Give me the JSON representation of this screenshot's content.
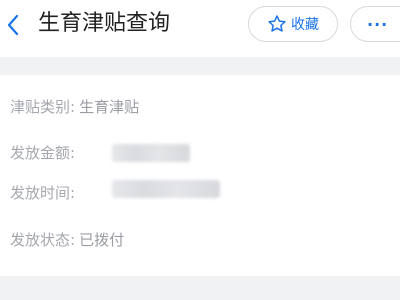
{
  "header": {
    "title": "生育津贴查询",
    "favorite_label": "收藏",
    "more_label": "···"
  },
  "details": [
    {
      "label": "津贴类别:",
      "value": "生育津贴"
    },
    {
      "label": "发放金额:",
      "value": ""
    },
    {
      "label": "发放时间:",
      "value": ""
    },
    {
      "label": "发放状态:",
      "value": "已拨付"
    }
  ],
  "icons": {
    "back": "chevron-left-icon",
    "favorite": "star-outline-icon"
  },
  "colors": {
    "accent": "#1a73e8",
    "label_text": "#a4a7ad",
    "separator": "#f1f2f4"
  }
}
